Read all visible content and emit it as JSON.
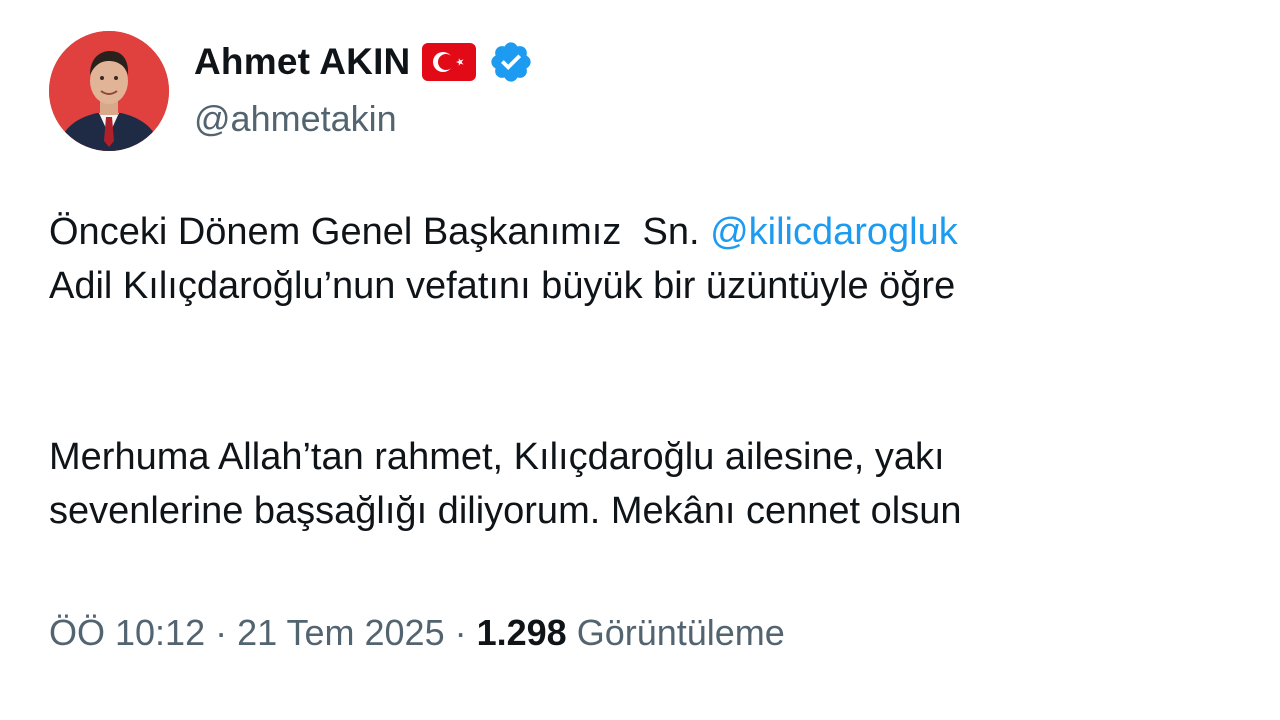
{
  "author": {
    "display_name": "Ahmet AKIN",
    "handle": "@ahmetakin"
  },
  "icons": {
    "flag": "turkey-flag-icon",
    "verified": "verified-badge-icon"
  },
  "colors": {
    "text": "#0f1419",
    "secondary": "#536471",
    "link": "#1d9bf0",
    "verified": "#1d9bf0",
    "flag_red": "#e30a17"
  },
  "tweet": {
    "para1_line1_text": "Önceki Dönem Genel Başkanımız  Sn. ",
    "para1_mention": "@kilicdarogluk",
    "para1_line2": "Adil Kılıçdaroğlu’nun vefatını büyük bir üzüntüyle öğre",
    "para2_line1": "Merhuma Allah’tan rahmet, Kılıçdaroğlu ailesine, yakı",
    "para2_line2": "sevenlerine başsağlığı diliyorum. Mekânı cennet olsun"
  },
  "meta": {
    "time": "ÖÖ 10:12",
    "separator": "·",
    "date": "21 Tem 2025",
    "views_count": "1.298",
    "views_label": "Görüntüleme"
  }
}
